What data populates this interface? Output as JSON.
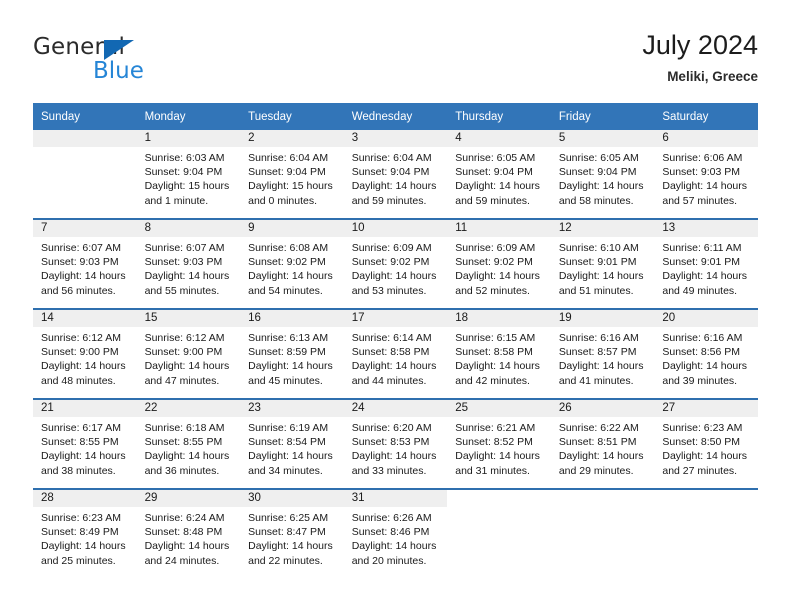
{
  "brand": {
    "name_top": "General",
    "name_bottom": "Blue",
    "triangle_color": "#1268b3",
    "blue_color": "#2585d6"
  },
  "header": {
    "title": "July 2024",
    "subtitle": "Meliki, Greece"
  },
  "colors": {
    "header_blue": "#3275b8",
    "row_divider_blue": "#2f6fae",
    "daynum_band": "#efefef"
  },
  "calendar": {
    "weekday_headers": [
      "Sunday",
      "Monday",
      "Tuesday",
      "Wednesday",
      "Thursday",
      "Friday",
      "Saturday"
    ],
    "weeks": [
      [
        {
          "day": "",
          "lines": []
        },
        {
          "day": "1",
          "lines": [
            "Sunrise: 6:03 AM",
            "Sunset: 9:04 PM",
            "Daylight: 15 hours and 1 minute."
          ]
        },
        {
          "day": "2",
          "lines": [
            "Sunrise: 6:04 AM",
            "Sunset: 9:04 PM",
            "Daylight: 15 hours and 0 minutes."
          ]
        },
        {
          "day": "3",
          "lines": [
            "Sunrise: 6:04 AM",
            "Sunset: 9:04 PM",
            "Daylight: 14 hours and 59 minutes."
          ]
        },
        {
          "day": "4",
          "lines": [
            "Sunrise: 6:05 AM",
            "Sunset: 9:04 PM",
            "Daylight: 14 hours and 59 minutes."
          ]
        },
        {
          "day": "5",
          "lines": [
            "Sunrise: 6:05 AM",
            "Sunset: 9:04 PM",
            "Daylight: 14 hours and 58 minutes."
          ]
        },
        {
          "day": "6",
          "lines": [
            "Sunrise: 6:06 AM",
            "Sunset: 9:03 PM",
            "Daylight: 14 hours and 57 minutes."
          ]
        }
      ],
      [
        {
          "day": "7",
          "lines": [
            "Sunrise: 6:07 AM",
            "Sunset: 9:03 PM",
            "Daylight: 14 hours and 56 minutes."
          ]
        },
        {
          "day": "8",
          "lines": [
            "Sunrise: 6:07 AM",
            "Sunset: 9:03 PM",
            "Daylight: 14 hours and 55 minutes."
          ]
        },
        {
          "day": "9",
          "lines": [
            "Sunrise: 6:08 AM",
            "Sunset: 9:02 PM",
            "Daylight: 14 hours and 54 minutes."
          ]
        },
        {
          "day": "10",
          "lines": [
            "Sunrise: 6:09 AM",
            "Sunset: 9:02 PM",
            "Daylight: 14 hours and 53 minutes."
          ]
        },
        {
          "day": "11",
          "lines": [
            "Sunrise: 6:09 AM",
            "Sunset: 9:02 PM",
            "Daylight: 14 hours and 52 minutes."
          ]
        },
        {
          "day": "12",
          "lines": [
            "Sunrise: 6:10 AM",
            "Sunset: 9:01 PM",
            "Daylight: 14 hours and 51 minutes."
          ]
        },
        {
          "day": "13",
          "lines": [
            "Sunrise: 6:11 AM",
            "Sunset: 9:01 PM",
            "Daylight: 14 hours and 49 minutes."
          ]
        }
      ],
      [
        {
          "day": "14",
          "lines": [
            "Sunrise: 6:12 AM",
            "Sunset: 9:00 PM",
            "Daylight: 14 hours and 48 minutes."
          ]
        },
        {
          "day": "15",
          "lines": [
            "Sunrise: 6:12 AM",
            "Sunset: 9:00 PM",
            "Daylight: 14 hours and 47 minutes."
          ]
        },
        {
          "day": "16",
          "lines": [
            "Sunrise: 6:13 AM",
            "Sunset: 8:59 PM",
            "Daylight: 14 hours and 45 minutes."
          ]
        },
        {
          "day": "17",
          "lines": [
            "Sunrise: 6:14 AM",
            "Sunset: 8:58 PM",
            "Daylight: 14 hours and 44 minutes."
          ]
        },
        {
          "day": "18",
          "lines": [
            "Sunrise: 6:15 AM",
            "Sunset: 8:58 PM",
            "Daylight: 14 hours and 42 minutes."
          ]
        },
        {
          "day": "19",
          "lines": [
            "Sunrise: 6:16 AM",
            "Sunset: 8:57 PM",
            "Daylight: 14 hours and 41 minutes."
          ]
        },
        {
          "day": "20",
          "lines": [
            "Sunrise: 6:16 AM",
            "Sunset: 8:56 PM",
            "Daylight: 14 hours and 39 minutes."
          ]
        }
      ],
      [
        {
          "day": "21",
          "lines": [
            "Sunrise: 6:17 AM",
            "Sunset: 8:55 PM",
            "Daylight: 14 hours and 38 minutes."
          ]
        },
        {
          "day": "22",
          "lines": [
            "Sunrise: 6:18 AM",
            "Sunset: 8:55 PM",
            "Daylight: 14 hours and 36 minutes."
          ]
        },
        {
          "day": "23",
          "lines": [
            "Sunrise: 6:19 AM",
            "Sunset: 8:54 PM",
            "Daylight: 14 hours and 34 minutes."
          ]
        },
        {
          "day": "24",
          "lines": [
            "Sunrise: 6:20 AM",
            "Sunset: 8:53 PM",
            "Daylight: 14 hours and 33 minutes."
          ]
        },
        {
          "day": "25",
          "lines": [
            "Sunrise: 6:21 AM",
            "Sunset: 8:52 PM",
            "Daylight: 14 hours and 31 minutes."
          ]
        },
        {
          "day": "26",
          "lines": [
            "Sunrise: 6:22 AM",
            "Sunset: 8:51 PM",
            "Daylight: 14 hours and 29 minutes."
          ]
        },
        {
          "day": "27",
          "lines": [
            "Sunrise: 6:23 AM",
            "Sunset: 8:50 PM",
            "Daylight: 14 hours and 27 minutes."
          ]
        }
      ],
      [
        {
          "day": "28",
          "lines": [
            "Sunrise: 6:23 AM",
            "Sunset: 8:49 PM",
            "Daylight: 14 hours and 25 minutes."
          ]
        },
        {
          "day": "29",
          "lines": [
            "Sunrise: 6:24 AM",
            "Sunset: 8:48 PM",
            "Daylight: 14 hours and 24 minutes."
          ]
        },
        {
          "day": "30",
          "lines": [
            "Sunrise: 6:25 AM",
            "Sunset: 8:47 PM",
            "Daylight: 14 hours and 22 minutes."
          ]
        },
        {
          "day": "31",
          "lines": [
            "Sunrise: 6:26 AM",
            "Sunset: 8:46 PM",
            "Daylight: 14 hours and 20 minutes."
          ]
        },
        {
          "day": "",
          "lines": []
        },
        {
          "day": "",
          "lines": []
        },
        {
          "day": "",
          "lines": []
        }
      ]
    ]
  }
}
